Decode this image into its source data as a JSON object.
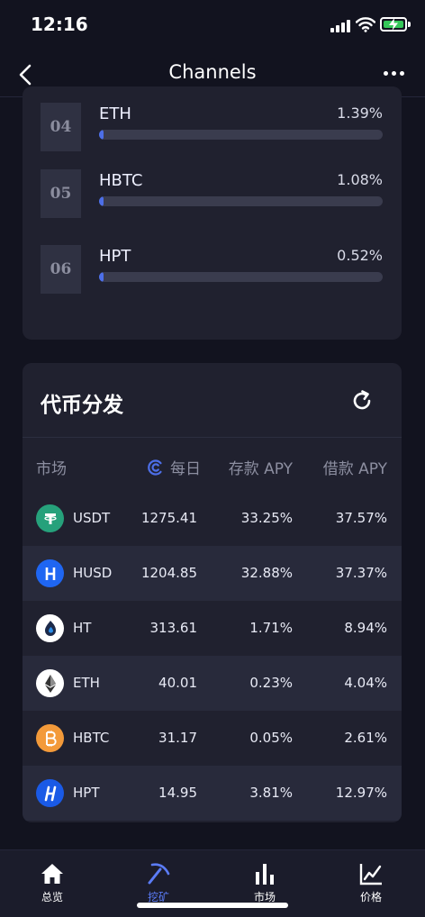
{
  "status": {
    "time": "12:16"
  },
  "nav": {
    "title": "Channels"
  },
  "ranking": [
    {
      "rank": "04",
      "name": "ETH",
      "pct": "1.39%",
      "fill": 0.0139
    },
    {
      "rank": "05",
      "name": "HBTC",
      "pct": "1.08%",
      "fill": 0.0108
    },
    {
      "rank": "06",
      "name": "HPT",
      "pct": "0.52%",
      "fill": 0.0052
    }
  ],
  "distribution": {
    "title": "代币分发",
    "headers": {
      "market": "市场",
      "daily": "每日",
      "deposit": "存款 APY",
      "borrow": "借款 APY"
    },
    "rows": [
      {
        "coin": "USDT",
        "icon": "usdt-icon",
        "color": "#26a17b",
        "daily": "1275.41",
        "deposit": "33.25%",
        "borrow": "37.57%"
      },
      {
        "coin": "HUSD",
        "icon": "husd-icon",
        "color": "#1f66f2",
        "daily": "1204.85",
        "deposit": "32.88%",
        "borrow": "37.37%"
      },
      {
        "coin": "HT",
        "icon": "ht-icon",
        "color": "#ffffff",
        "daily": "313.61",
        "deposit": "1.71%",
        "borrow": "8.94%"
      },
      {
        "coin": "ETH",
        "icon": "eth-icon",
        "color": "#ffffff",
        "daily": "40.01",
        "deposit": "0.23%",
        "borrow": "4.04%"
      },
      {
        "coin": "HBTC",
        "icon": "hbtc-icon",
        "color": "#f39a3a",
        "daily": "31.17",
        "deposit": "0.05%",
        "borrow": "2.61%"
      },
      {
        "coin": "HPT",
        "icon": "hpt-icon",
        "color": "#1a5ae6",
        "daily": "14.95",
        "deposit": "3.81%",
        "borrow": "12.97%"
      }
    ]
  },
  "tabs": [
    {
      "label": "总览",
      "icon": "home-icon",
      "active": false
    },
    {
      "label": "挖矿",
      "icon": "pickaxe-icon",
      "active": true
    },
    {
      "label": "市场",
      "icon": "bar-chart-icon",
      "active": false
    },
    {
      "label": "价格",
      "icon": "line-chart-icon",
      "active": false
    }
  ],
  "colors": {
    "accent": "#4d6fe8",
    "active_tab": "#5b7cf7",
    "card": "#20212f",
    "background": "#12131f"
  }
}
